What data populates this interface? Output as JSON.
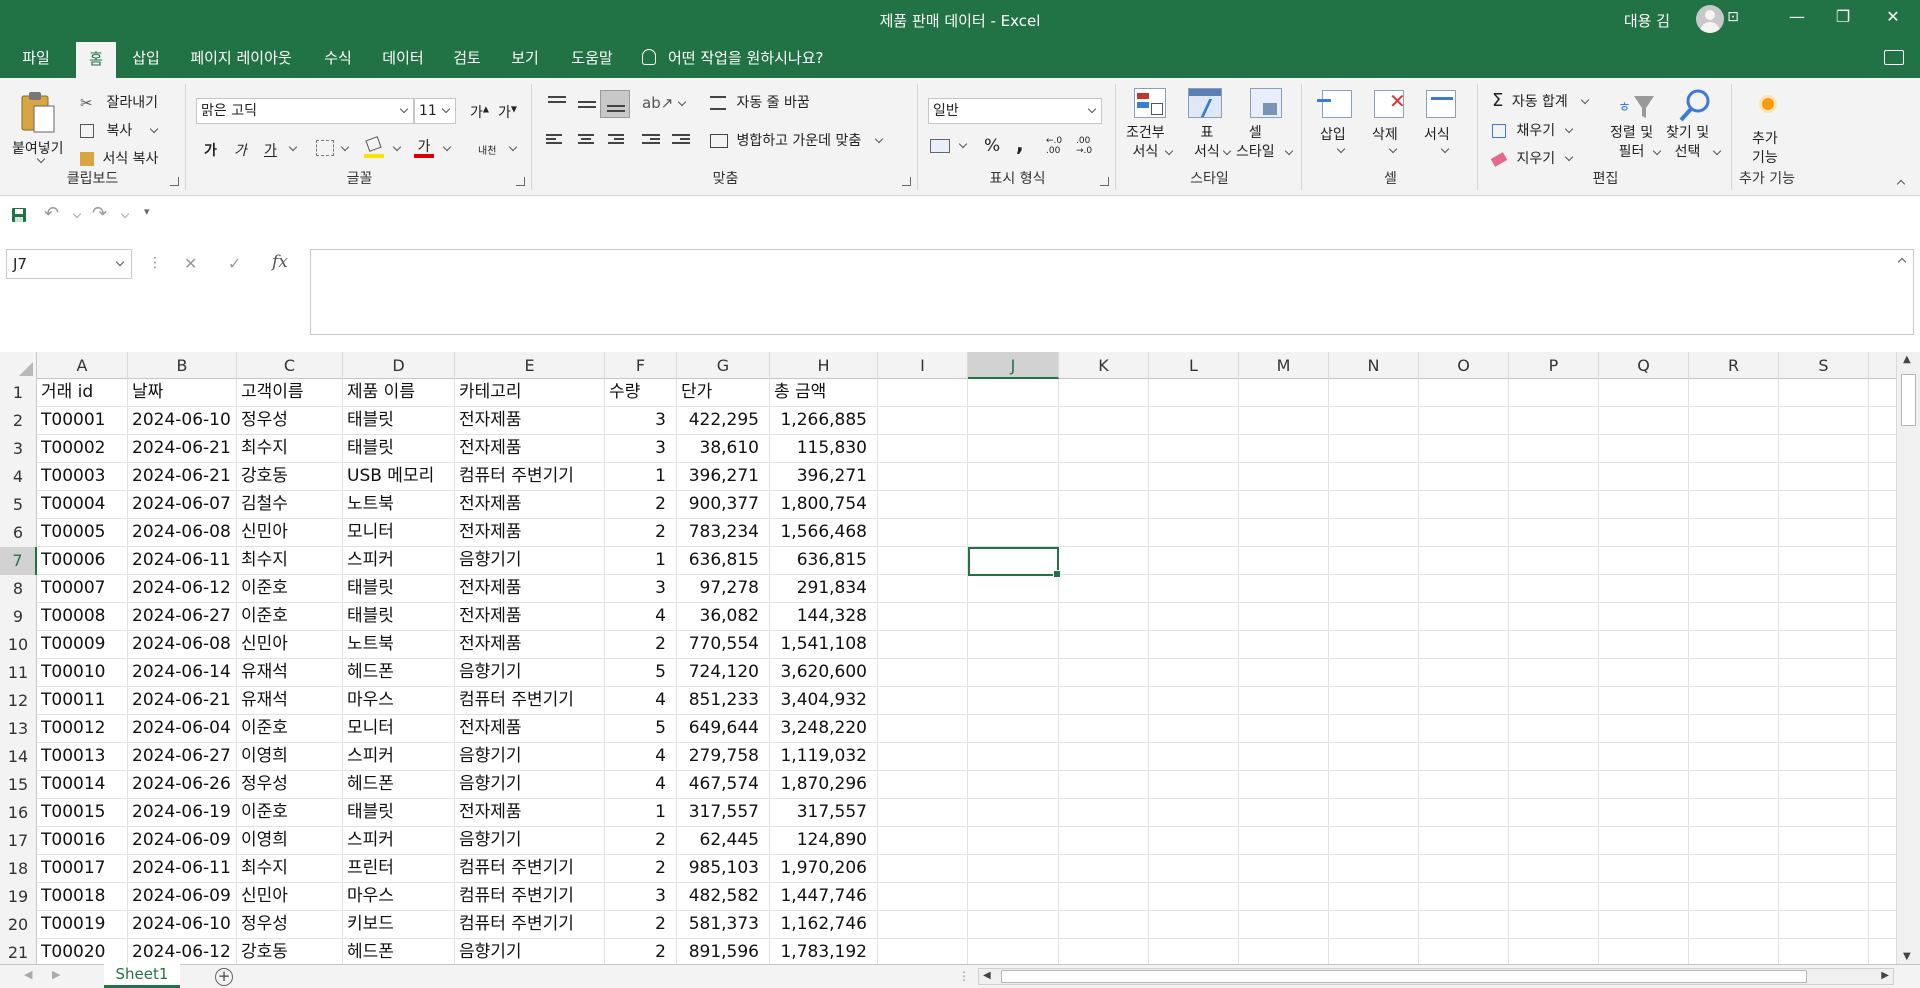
{
  "window": {
    "title": "제품 판매 데이터  -  Excel",
    "user": "대용 김",
    "minimize": "—",
    "restore": "❐",
    "close": "✕",
    "ribbon_display": "⊡"
  },
  "tabs": [
    {
      "label": "파일"
    },
    {
      "label": "홈"
    },
    {
      "label": "삽입"
    },
    {
      "label": "페이지 레이아웃"
    },
    {
      "label": "수식"
    },
    {
      "label": "데이터"
    },
    {
      "label": "검토"
    },
    {
      "label": "보기"
    },
    {
      "label": "도움말"
    }
  ],
  "active_tab": "홈",
  "tell_me": "어떤 작업을 원하시나요?",
  "ribbon": {
    "clipboard": {
      "label": "클립보드",
      "paste": "붙여넣기",
      "cut": "잘라내기",
      "copy": "복사",
      "format_painter": "서식 복사"
    },
    "font": {
      "label": "글꼴",
      "font_name": "맑은 고딕",
      "font_size": "11",
      "grow": "가",
      "shrink": "가",
      "bold": "가",
      "italic": "가",
      "underline": "가",
      "font_color_glyph": "가",
      "phonetic": "내천"
    },
    "alignment": {
      "label": "맞춤",
      "wrap_text": "자동 줄 바꿈",
      "merge_center": "병합하고 가운데 맞춤"
    },
    "number": {
      "label": "표시 형식",
      "format": "일반",
      "percent": "%",
      "comma": ",",
      "inc_decimal": "←.0\n.00",
      "dec_decimal": ".00\n→.0"
    },
    "styles": {
      "label": "스타일",
      "conditional": "조건부\n서식",
      "table": "표\n서식",
      "cell_styles": "셀\n스타일"
    },
    "cells": {
      "label": "셀",
      "insert": "삽입",
      "delete": "삭제",
      "format": "서식"
    },
    "editing": {
      "label": "편집",
      "autosum": "자동 합계",
      "fill": "채우기",
      "clear": "지우기",
      "sort_filter": "정렬 및\n필터",
      "find_select": "찾기 및\n선택"
    },
    "addins": {
      "label": "추가 기능",
      "button": "추가\n기능"
    }
  },
  "name_box": "J7",
  "formula_bar": {
    "cancel": "✕",
    "enter": "✓",
    "fx": "fx",
    "content": ""
  },
  "columns": [
    "A",
    "B",
    "C",
    "D",
    "E",
    "F",
    "G",
    "H",
    "I",
    "J",
    "K",
    "L",
    "M",
    "N",
    "O",
    "P",
    "Q",
    "R",
    "S"
  ],
  "selected_cell": {
    "column": "J",
    "row": 7
  },
  "header_row": [
    "거래 id",
    "날짜",
    "고객이름",
    "제품 이름",
    "카테고리",
    "수량",
    "단가",
    "총 금액"
  ],
  "rows": [
    [
      "T00001",
      "2024-06-10",
      "정우성",
      "태블릿",
      "전자제품",
      "3",
      "422,295",
      "1,266,885"
    ],
    [
      "T00002",
      "2024-06-21",
      "최수지",
      "태블릿",
      "전자제품",
      "3",
      "38,610",
      "115,830"
    ],
    [
      "T00003",
      "2024-06-21",
      "강호동",
      "USB 메모리",
      "컴퓨터 주변기기",
      "1",
      "396,271",
      "396,271"
    ],
    [
      "T00004",
      "2024-06-07",
      "김철수",
      "노트북",
      "전자제품",
      "2",
      "900,377",
      "1,800,754"
    ],
    [
      "T00005",
      "2024-06-08",
      "신민아",
      "모니터",
      "전자제품",
      "2",
      "783,234",
      "1,566,468"
    ],
    [
      "T00006",
      "2024-06-11",
      "최수지",
      "스피커",
      "음향기기",
      "1",
      "636,815",
      "636,815"
    ],
    [
      "T00007",
      "2024-06-12",
      "이준호",
      "태블릿",
      "전자제품",
      "3",
      "97,278",
      "291,834"
    ],
    [
      "T00008",
      "2024-06-27",
      "이준호",
      "태블릿",
      "전자제품",
      "4",
      "36,082",
      "144,328"
    ],
    [
      "T00009",
      "2024-06-08",
      "신민아",
      "노트북",
      "전자제품",
      "2",
      "770,554",
      "1,541,108"
    ],
    [
      "T00010",
      "2024-06-14",
      "유재석",
      "헤드폰",
      "음향기기",
      "5",
      "724,120",
      "3,620,600"
    ],
    [
      "T00011",
      "2024-06-21",
      "유재석",
      "마우스",
      "컴퓨터 주변기기",
      "4",
      "851,233",
      "3,404,932"
    ],
    [
      "T00012",
      "2024-06-04",
      "이준호",
      "모니터",
      "전자제품",
      "5",
      "649,644",
      "3,248,220"
    ],
    [
      "T00013",
      "2024-06-27",
      "이영희",
      "스피커",
      "음향기기",
      "4",
      "279,758",
      "1,119,032"
    ],
    [
      "T00014",
      "2024-06-26",
      "정우성",
      "헤드폰",
      "음향기기",
      "4",
      "467,574",
      "1,870,296"
    ],
    [
      "T00015",
      "2024-06-19",
      "이준호",
      "태블릿",
      "전자제품",
      "1",
      "317,557",
      "317,557"
    ],
    [
      "T00016",
      "2024-06-09",
      "이영희",
      "스피커",
      "음향기기",
      "2",
      "62,445",
      "124,890"
    ],
    [
      "T00017",
      "2024-06-11",
      "최수지",
      "프린터",
      "컴퓨터 주변기기",
      "2",
      "985,103",
      "1,970,206"
    ],
    [
      "T00018",
      "2024-06-09",
      "신민아",
      "마우스",
      "컴퓨터 주변기기",
      "3",
      "482,582",
      "1,447,746"
    ],
    [
      "T00019",
      "2024-06-10",
      "정우성",
      "키보드",
      "컴퓨터 주변기기",
      "2",
      "581,373",
      "1,162,746"
    ],
    [
      "T00020",
      "2024-06-12",
      "강호동",
      "헤드폰",
      "음향기기",
      "2",
      "891,596",
      "1,783,192"
    ]
  ],
  "row_numbers": [
    "1",
    "2",
    "3",
    "4",
    "5",
    "6",
    "7",
    "8",
    "9",
    "10",
    "11",
    "12",
    "13",
    "14",
    "15",
    "16",
    "17",
    "18",
    "19",
    "20",
    "21"
  ],
  "sheet_tab": "Sheet1",
  "add_sheet": "+",
  "colors": {
    "excel_green": "#217346",
    "ribbon_bg": "#f3f3f3",
    "selection": "#217346"
  }
}
